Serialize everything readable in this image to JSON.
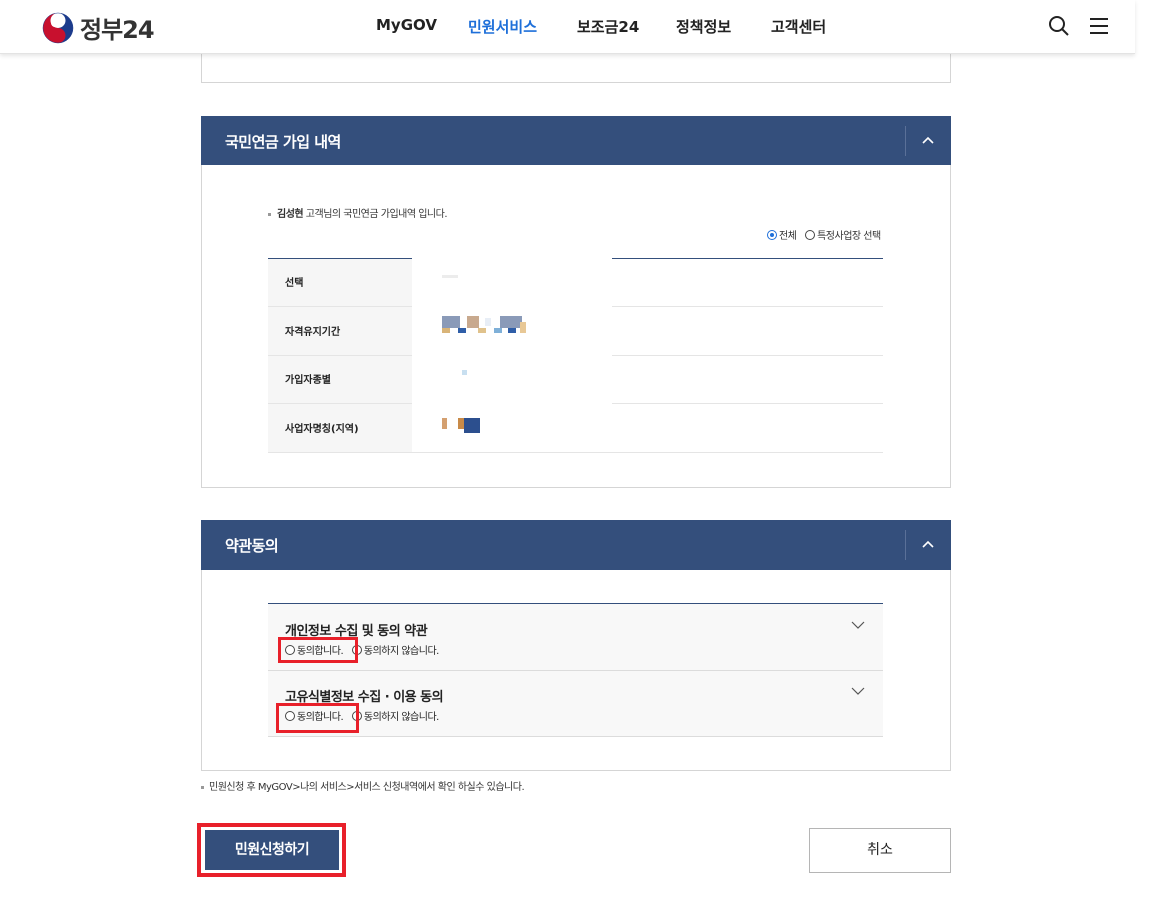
{
  "header": {
    "logo_text": "정부24",
    "nav": [
      {
        "label": "MyGOV"
      },
      {
        "label": "민원서비스"
      },
      {
        "label": "보조금24"
      },
      {
        "label": "정책정보"
      },
      {
        "label": "고객센터"
      }
    ],
    "active_nav": "민원서비스",
    "icons": [
      "search-icon",
      "menu-icon"
    ]
  },
  "pension": {
    "title": "국민연금 가입 내역",
    "intro_name": "김성현",
    "intro_text": " 고객님의 국민연금 가입내역 입니다.",
    "filter": {
      "all_label": "전체",
      "specific_label": "특정사업장 선택",
      "selected": "전체"
    },
    "rows": [
      {
        "label": "선택"
      },
      {
        "label": "자격유지기간"
      },
      {
        "label": "가입자종별"
      },
      {
        "label": "사업자명칭(지역)"
      }
    ]
  },
  "terms": {
    "title": "약관동의",
    "items": [
      {
        "title": "개인정보 수집 및 동의 약관",
        "agree_label": "동의합니다.",
        "disagree_label": "동의하지 않습니다."
      },
      {
        "title": "고유식별정보 수집 · 이용 동의",
        "agree_label": "동의합니다.",
        "disagree_label": "동의하지 않습니다."
      }
    ]
  },
  "footer_note": "민원신청 후 MyGOV>나의 서비스>서비스 신청내역에서 확인 하실수 있습니다.",
  "buttons": {
    "submit": "민원신청하기",
    "cancel": "취소"
  },
  "colors": {
    "section_header": "#344f7c",
    "active_nav": "#1e6fd9",
    "highlight": "#e8202a"
  }
}
